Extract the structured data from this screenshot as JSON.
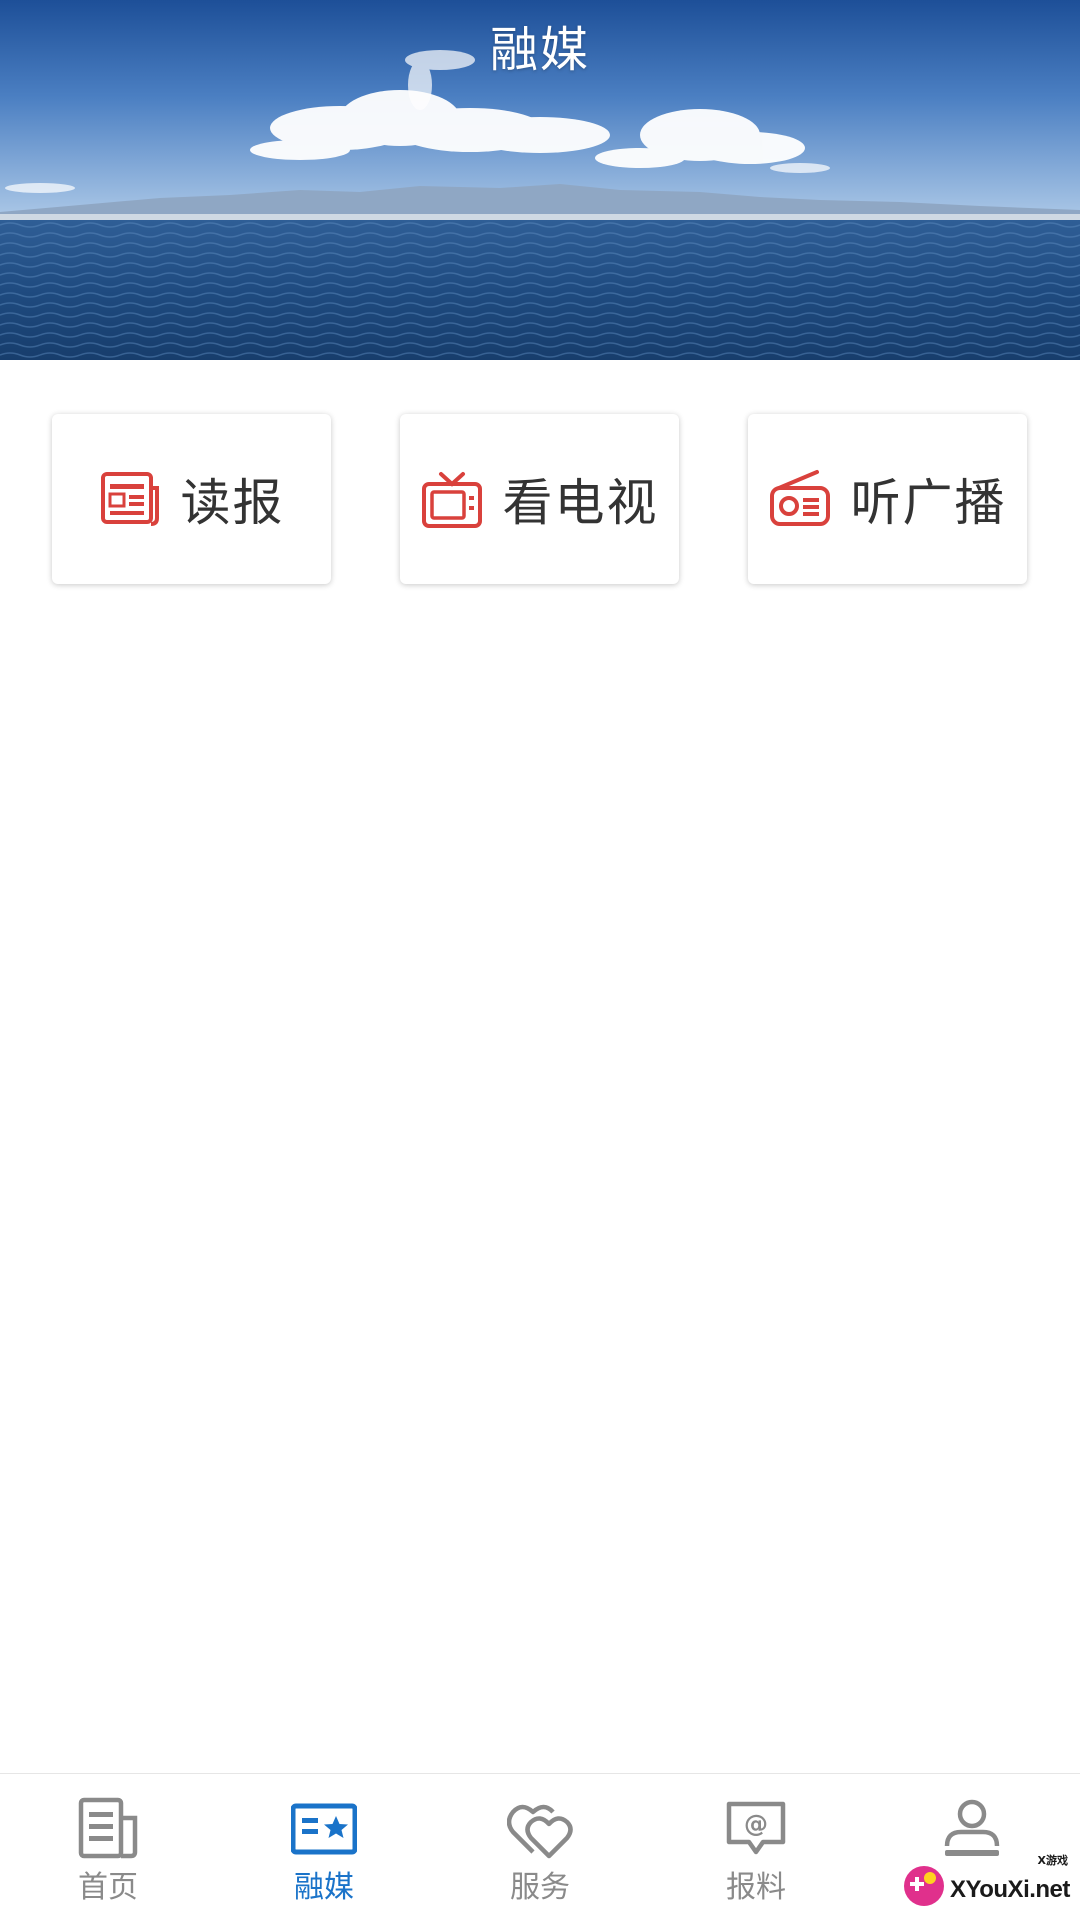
{
  "header": {
    "title": "融媒"
  },
  "media_cards": [
    {
      "label": "读报",
      "icon": "newspaper-icon"
    },
    {
      "label": "看电视",
      "icon": "tv-icon"
    },
    {
      "label": "听广播",
      "icon": "radio-icon"
    }
  ],
  "tabbar": {
    "items": [
      {
        "label": "首页",
        "icon": "document-icon",
        "active": false
      },
      {
        "label": "融媒",
        "icon": "media-card-star-icon",
        "active": true
      },
      {
        "label": "服务",
        "icon": "hearts-icon",
        "active": false
      },
      {
        "label": "报料",
        "icon": "at-message-icon",
        "active": false
      },
      {
        "label": "",
        "icon": "user-icon",
        "active": false
      }
    ]
  },
  "watermark": {
    "site": "XYouXi.net",
    "small": "X游戏"
  },
  "colors": {
    "accent_red": "#d9413c",
    "active_blue": "#1a73c9",
    "inactive_gray": "#8a8a8a",
    "text_dark": "#333333"
  }
}
